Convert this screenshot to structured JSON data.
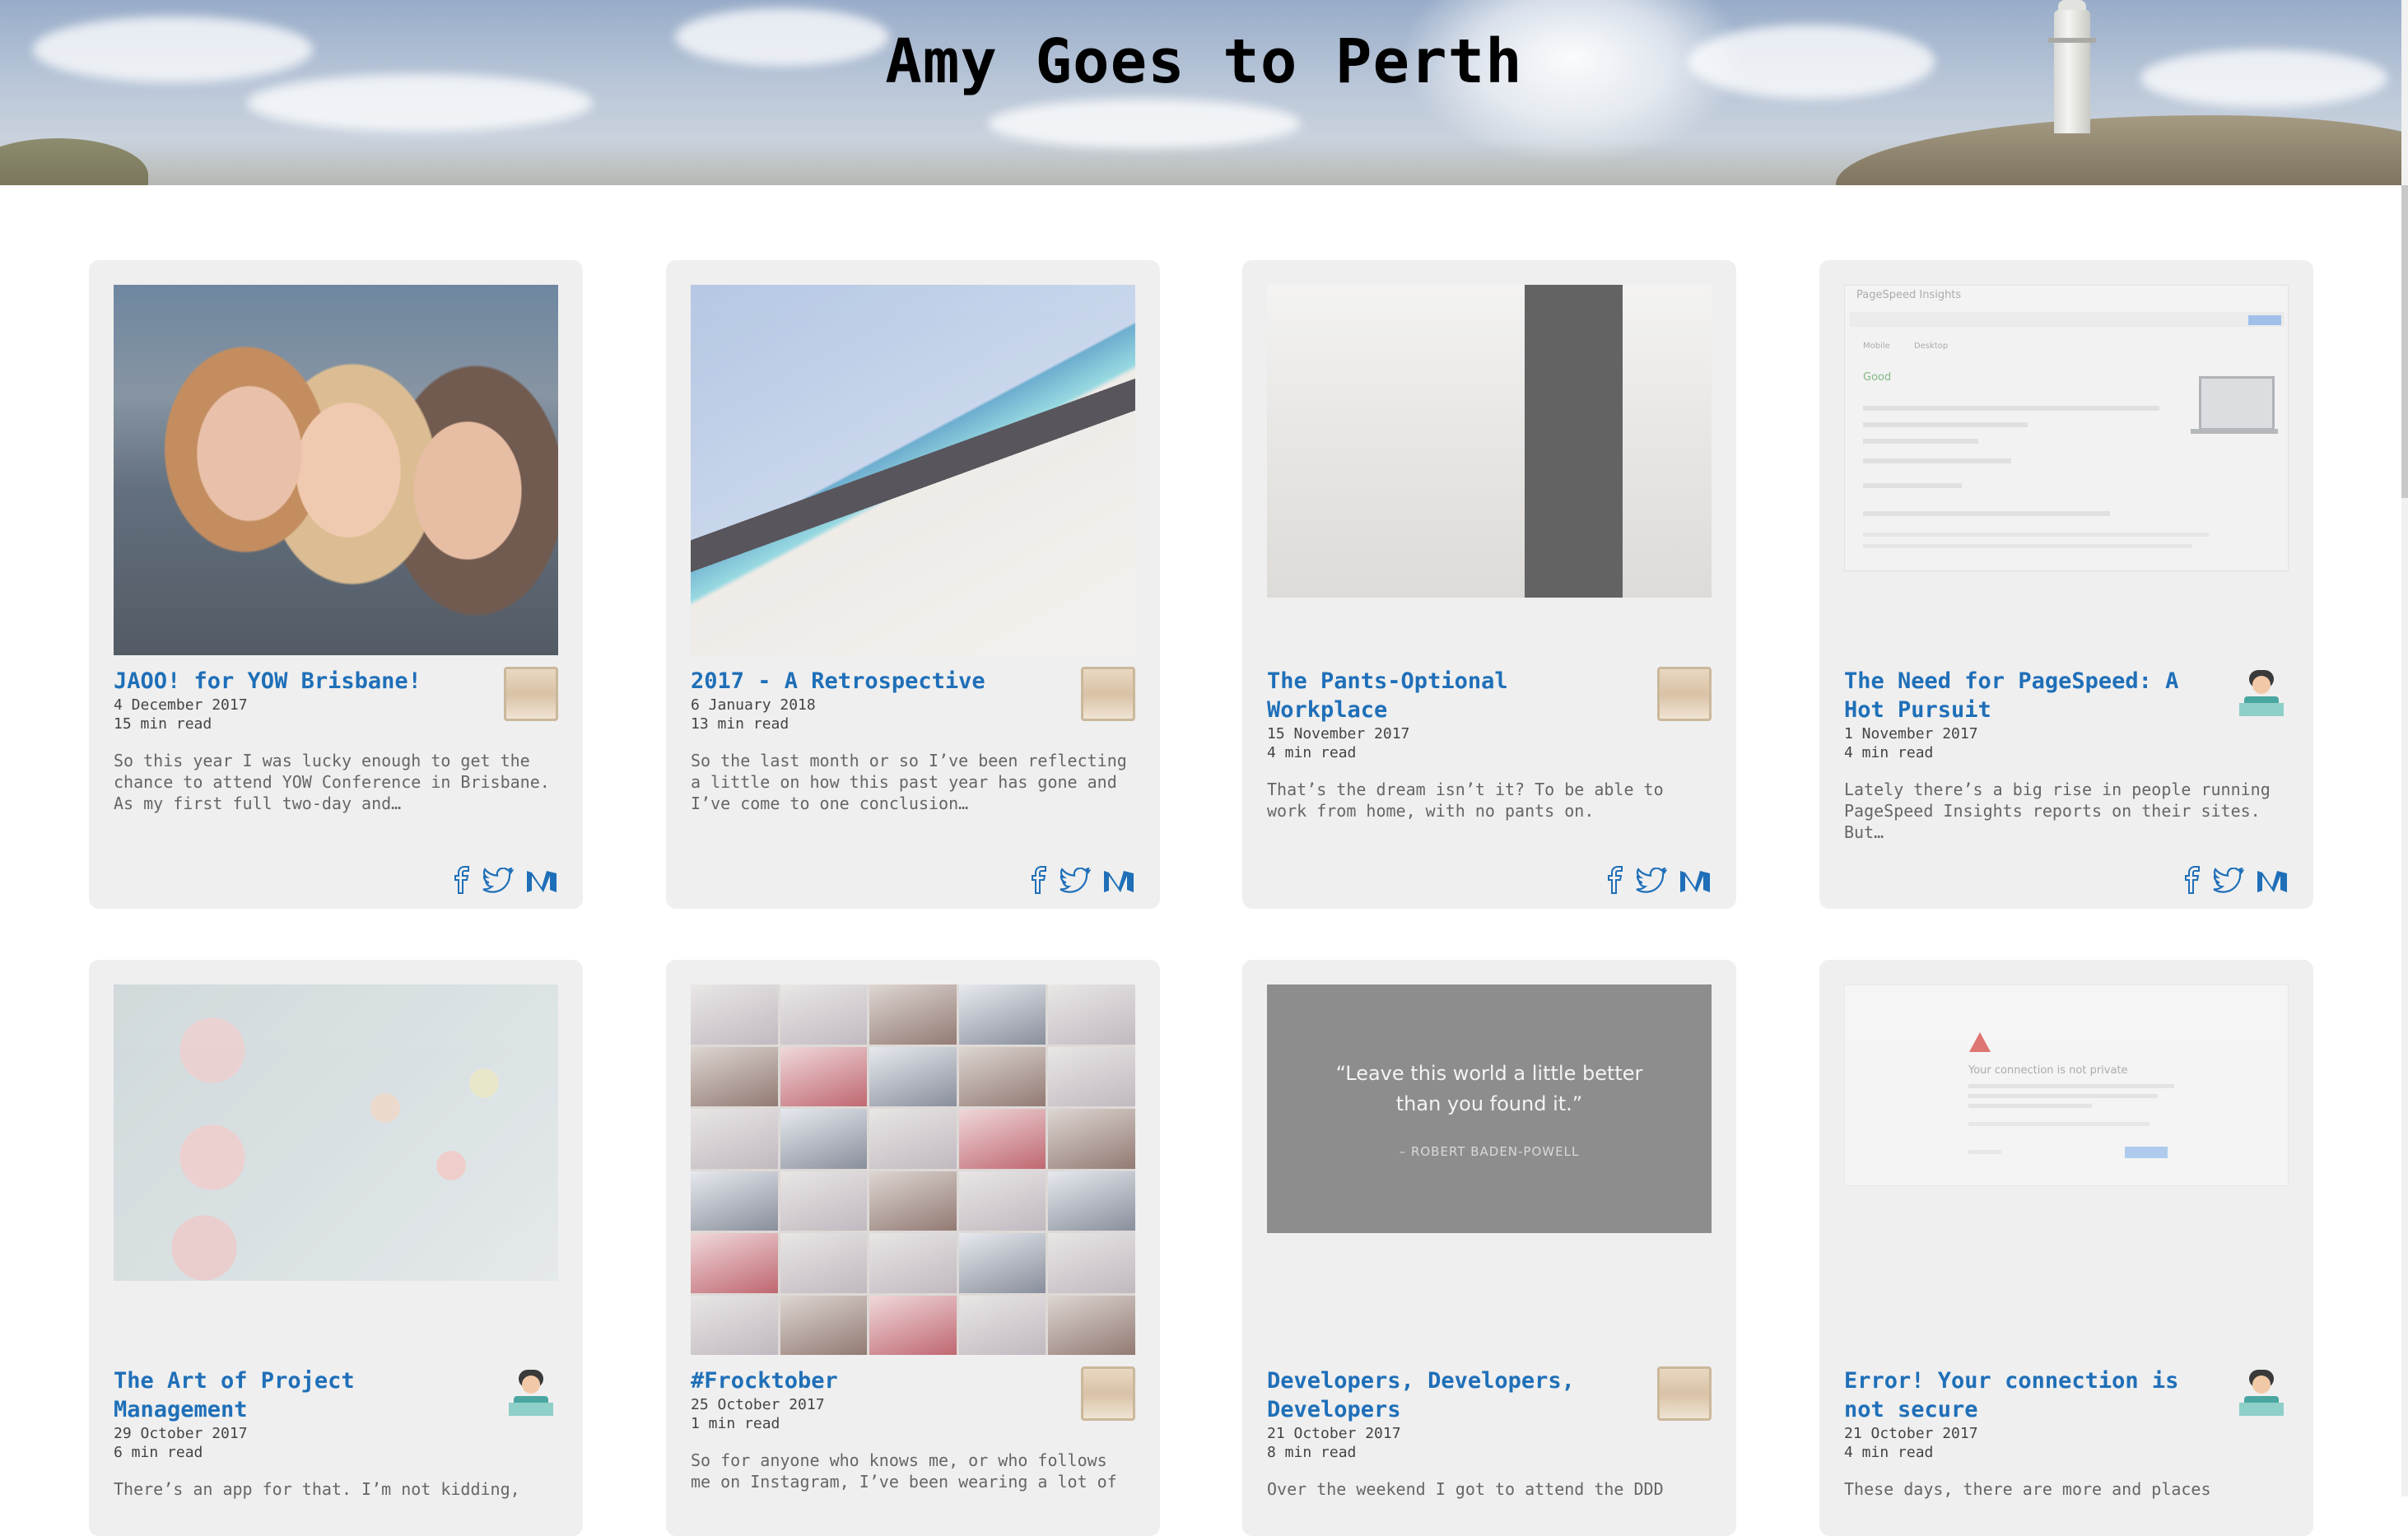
{
  "site": {
    "title": "Amy Goes to Perth"
  },
  "posts_row1": [
    {
      "title": "JAOO! for YOW Brisbane!",
      "date": "4 December 2017",
      "read_time": "15 min read",
      "excerpt": "So this year I was lucky enough to get the chance to attend YOW Conference in Brisbane. As my first full two-day and…",
      "avatar": "photo"
    },
    {
      "title": "2017 - A Retrospective",
      "date": "6 January 2018",
      "read_time": "13 min read",
      "excerpt": "So the last month or so I’ve been reflecting a little on how this past year has gone and I’ve come to one conclusion…",
      "avatar": "photo"
    },
    {
      "title": "The Pants-Optional Workplace",
      "date": "15 November 2017",
      "read_time": "4 min read",
      "excerpt": "That’s the dream isn’t it? To be able to work from home, with no pants on.",
      "avatar": "photo"
    },
    {
      "title": "The Need for PageSpeed: A Hot Pursuit",
      "date": "1 November 2017",
      "read_time": "4 min read",
      "excerpt": "Lately there’s a big rise in people running PageSpeed Insights reports on their sites. But…",
      "avatar": "cartoon",
      "thumb_text": {
        "heading": "PageSpeed Insights",
        "good": "Good",
        "tab_mobile": "Mobile",
        "tab_desktop": "Desktop"
      }
    }
  ],
  "posts_row2": [
    {
      "title": "The Art of Project Management",
      "date": "29 October 2017",
      "read_time": "6 min read",
      "excerpt": "There’s an app for that. I’m not kidding,",
      "avatar": "cartoon"
    },
    {
      "title": "#Frocktober",
      "date": "25 October 2017",
      "read_time": "1 min read",
      "excerpt": "So for anyone who knows me, or who follows me on Instagram, I’ve been wearing a lot of",
      "avatar": "photo"
    },
    {
      "title": "Developers, Developers, Developers",
      "date": "21 October 2017",
      "read_time": "8 min read",
      "excerpt": "Over the weekend I got to attend the DDD",
      "avatar": "photo",
      "quote": {
        "line1": "“Leave this world a little better",
        "line2": "than you found it.”",
        "author": "– ROBERT BADEN-POWELL"
      }
    },
    {
      "title": "Error! Your connection is not secure",
      "date": "21 October 2017",
      "read_time": "4 min read",
      "excerpt": "These days, there are more and places",
      "avatar": "cartoon",
      "thumb_text": {
        "message": "Your connection is not private"
      }
    }
  ],
  "icons": {
    "social": [
      "facebook-icon",
      "twitter-icon",
      "medium-icon"
    ],
    "colors": {
      "link": "#1f6fb8",
      "card_bg": "#efefef"
    }
  }
}
